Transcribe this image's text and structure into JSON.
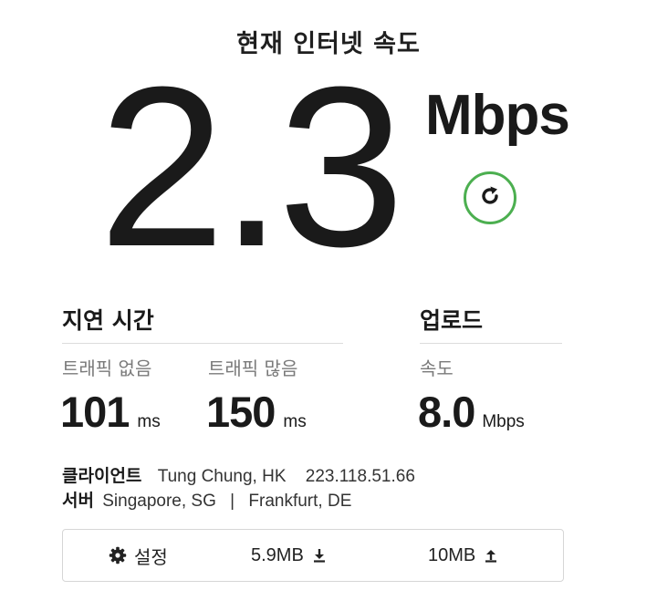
{
  "header": {
    "title": "현재 인터넷 속도"
  },
  "speed": {
    "value": "2.3",
    "unit": "Mbps"
  },
  "latency": {
    "heading": "지연 시간",
    "unloaded": {
      "label": "트래픽 없음",
      "value": "101",
      "unit": "ms"
    },
    "loaded": {
      "label": "트래픽 많음",
      "value": "150",
      "unit": "ms"
    }
  },
  "upload": {
    "heading": "업로드",
    "label": "속도",
    "value": "8.0",
    "unit": "Mbps"
  },
  "client": {
    "label": "클라이언트",
    "location": "Tung Chung, HK",
    "ip": "223.118.51.66"
  },
  "server": {
    "label": "서버",
    "locations": "Singapore, SG",
    "separator": "|",
    "locations2": "Frankfurt, DE"
  },
  "toolbar": {
    "settings_label": "설정",
    "download_size": "5.9MB",
    "upload_size": "10MB"
  },
  "colors": {
    "accent": "#4caf50",
    "text": "#1a1a1a",
    "muted": "#7a7a7a"
  },
  "icons": {
    "refresh": "refresh-icon",
    "settings": "gear-icon",
    "download": "download-icon",
    "upload": "upload-icon"
  }
}
